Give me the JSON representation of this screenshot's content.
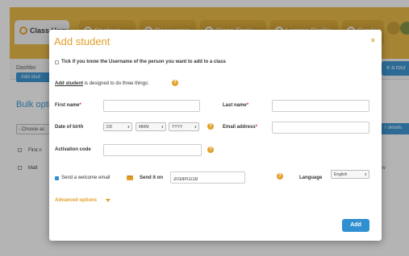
{
  "background": {
    "tabs": [
      {
        "label": "Class Home",
        "active": true
      },
      {
        "label": "Student",
        "active": false
      },
      {
        "label": "Resources",
        "active": false
      },
      {
        "label": "Class Tools",
        "active": false
      },
      {
        "label": "Lesson Profile",
        "active": false
      },
      {
        "label": "Grades",
        "active": false
      }
    ],
    "subbar_label": "Dashbo",
    "tour_button": "e a tour",
    "add_button": "Add stud",
    "bulk_heading": "Bulk optio",
    "choose_select": "- Choose ac",
    "details_button": "r details",
    "rows": [
      "First n",
      "Matt"
    ],
    "row_right_text": "ow",
    "accent_color": "#e8b53a",
    "blue_color": "#2f8fd1"
  },
  "modal": {
    "title": "Add student",
    "close_icon": "×",
    "tick_text": "Tick if you know the Username of the person you want to add to a class",
    "intro_link": "Add student",
    "intro_text": " is designed to do three things:",
    "help_glyph": "?",
    "first_name_label": "First name",
    "last_name_label": "Last name",
    "required_mark": "*",
    "dob_label": "Date of birth",
    "dob_day": "DD",
    "dob_month": "MMM",
    "dob_year": "YYYY",
    "email_label": "Email address",
    "activation_label": "Activation code",
    "welcome_label": "Send a welcome email",
    "send_on_label": "Send it on",
    "send_date": "2018/01/18",
    "language_label": "Language",
    "language_value": "English",
    "advanced_label": "Advanced options",
    "add_button": "Add"
  }
}
